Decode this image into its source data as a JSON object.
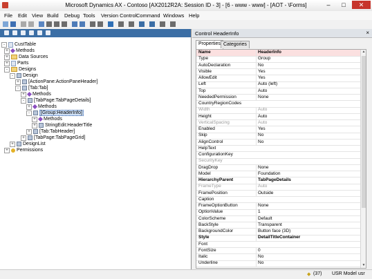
{
  "window": {
    "title": "Microsoft Dynamics AX - Contoso [AX2012R2A: Session ID - 3] - [6 - www - www] - [AOT - \\Forms]",
    "min": "–",
    "max": "□",
    "close": "✕"
  },
  "menu": [
    "File",
    "Edit",
    "View",
    "Build",
    "Debug",
    "Tools",
    "Version Control",
    "Command",
    "Windows",
    "Help"
  ],
  "tree": [
    {
      "label": "CustTable",
      "exp": "-",
      "icon": "doc"
    },
    {
      "label": "Methods",
      "exp": "+",
      "icon": "method"
    },
    {
      "label": "Data Sources",
      "exp": "+",
      "icon": "folder"
    },
    {
      "label": "Parts",
      "exp": "+",
      "icon": "doc"
    },
    {
      "label": "Designs",
      "exp": "-",
      "icon": "folder"
    },
    {
      "label": "Design",
      "exp": "-",
      "icon": "ctl"
    },
    {
      "label": "[ActionPane:ActionPaneHeader]",
      "exp": "+",
      "icon": "ctl"
    },
    {
      "label": "[Tab:Tab]",
      "exp": "-",
      "icon": "ctl"
    },
    {
      "label": "Methods",
      "exp": "+",
      "icon": "method"
    },
    {
      "label": "[TabPage:TabPageDetails]",
      "exp": "-",
      "icon": "ctl"
    },
    {
      "label": "Methods",
      "exp": "+",
      "icon": "method"
    },
    {
      "label": "[Group:HeaderInfo]",
      "exp": "-",
      "icon": "ctl"
    },
    {
      "label": "Methods",
      "exp": "+",
      "icon": "method"
    },
    {
      "label": "StringEdit:HeaderTitle",
      "exp": "+",
      "icon": "ctl"
    },
    {
      "label": "[Tab:TabHeader]",
      "exp": "+",
      "icon": "ctl"
    },
    {
      "label": "[TabPage:TabPageGrid]",
      "exp": "+",
      "icon": "ctl"
    },
    {
      "label": "DesignList",
      "exp": "+",
      "icon": "ctl"
    },
    {
      "label": "Permissions",
      "exp": "+",
      "icon": "perm"
    }
  ],
  "props_panel": {
    "title": "Control HeaderInfo",
    "close": "×",
    "tabs": [
      "Properties",
      "Categories"
    ],
    "rows": [
      {
        "k": "Name",
        "v": "HeaderInfo",
        "style": "bold hdr"
      },
      {
        "k": "Type",
        "v": "Group",
        "style": ""
      },
      {
        "k": "AutoDeclaration",
        "v": "No",
        "style": ""
      },
      {
        "k": "Visible",
        "v": "Yes",
        "style": ""
      },
      {
        "k": "AllowEdit",
        "v": "Yes",
        "style": ""
      },
      {
        "k": "Left",
        "v": "Auto (left)",
        "style": ""
      },
      {
        "k": "Top",
        "v": "Auto",
        "style": ""
      },
      {
        "k": "NeededPermission",
        "v": "None",
        "style": ""
      },
      {
        "k": "CountryRegionCodes",
        "v": "",
        "style": "yellow"
      },
      {
        "k": "Width",
        "v": "Auto",
        "style": "grey"
      },
      {
        "k": "Height",
        "v": "Auto",
        "style": ""
      },
      {
        "k": "VerticalSpacing",
        "v": "Auto",
        "style": "grey"
      },
      {
        "k": "Enabled",
        "v": "Yes",
        "style": ""
      },
      {
        "k": "Skip",
        "v": "No",
        "style": ""
      },
      {
        "k": "AlignControl",
        "v": "No",
        "style": ""
      },
      {
        "k": "HelpText",
        "v": "",
        "style": "yellow"
      },
      {
        "k": "ConfigurationKey",
        "v": "",
        "style": ""
      },
      {
        "k": "SecurityKey",
        "v": "",
        "style": "grey"
      },
      {
        "k": "DragDrop",
        "v": "None",
        "style": ""
      },
      {
        "k": "Model",
        "v": "Foundation",
        "style": ""
      },
      {
        "k": "HierarchyParent",
        "v": "TabPageDetails",
        "style": "bold"
      },
      {
        "k": "FrameType",
        "v": "Auto",
        "style": "grey"
      },
      {
        "k": "FramePosition",
        "v": "Outside",
        "style": ""
      },
      {
        "k": "Caption",
        "v": "",
        "style": "yellow"
      },
      {
        "k": "FrameOptionButton",
        "v": "None",
        "style": ""
      },
      {
        "k": "OptionValue",
        "v": "1",
        "style": ""
      },
      {
        "k": "ColorScheme",
        "v": "Default",
        "style": ""
      },
      {
        "k": "BackStyle",
        "v": "Transparent",
        "style": ""
      },
      {
        "k": "BackgroundColor",
        "v": "Button face (3D)",
        "style": ""
      },
      {
        "k": "Style",
        "v": "DetailTitleContainer",
        "style": "bold"
      },
      {
        "k": "Font",
        "v": "",
        "style": ""
      },
      {
        "k": "FontSize",
        "v": "0",
        "style": ""
      },
      {
        "k": "Italic",
        "v": "No",
        "style": ""
      },
      {
        "k": "Underline",
        "v": "No",
        "style": ""
      }
    ]
  },
  "status": {
    "count": "(37)",
    "model": "USR Model",
    "user": "usr"
  }
}
